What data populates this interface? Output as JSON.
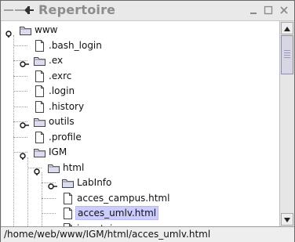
{
  "window": {
    "title": "Repertoire",
    "controls": {
      "minimize_icon": "minimize-icon",
      "maximize_icon": "maximize-icon",
      "close_icon": "close-icon"
    }
  },
  "tree": {
    "nodes": [
      {
        "label": "www",
        "type": "folder",
        "expanded": true,
        "depth": 0,
        "has_toggle": true
      },
      {
        "label": ".bash_login",
        "type": "file",
        "depth": 1
      },
      {
        "label": ".ex",
        "type": "folder",
        "expanded": false,
        "depth": 1,
        "has_toggle": true
      },
      {
        "label": ".exrc",
        "type": "file",
        "depth": 1
      },
      {
        "label": ".login",
        "type": "file",
        "depth": 1
      },
      {
        "label": ".history",
        "type": "file",
        "depth": 1
      },
      {
        "label": "outils",
        "type": "folder",
        "expanded": false,
        "depth": 1,
        "has_toggle": true
      },
      {
        "label": ".profile",
        "type": "file",
        "depth": 1
      },
      {
        "label": "IGM",
        "type": "folder",
        "expanded": true,
        "depth": 1,
        "has_toggle": true
      },
      {
        "label": "html",
        "type": "folder",
        "expanded": true,
        "depth": 2,
        "has_toggle": true
      },
      {
        "label": "LabInfo",
        "type": "folder",
        "expanded": false,
        "depth": 3,
        "has_toggle": true
      },
      {
        "label": "acces_campus.html",
        "type": "file",
        "depth": 3
      },
      {
        "label": "acces_umlv.html",
        "type": "file",
        "depth": 3,
        "selected": true
      },
      {
        "label": "imontoises",
        "type": "file",
        "depth": 3
      }
    ]
  },
  "status_bar": {
    "path": "/home/web/www/IGM/html/acces_umlv.html"
  },
  "colors": {
    "selection": "#ccccff",
    "title_text": "#8c8c8c"
  }
}
